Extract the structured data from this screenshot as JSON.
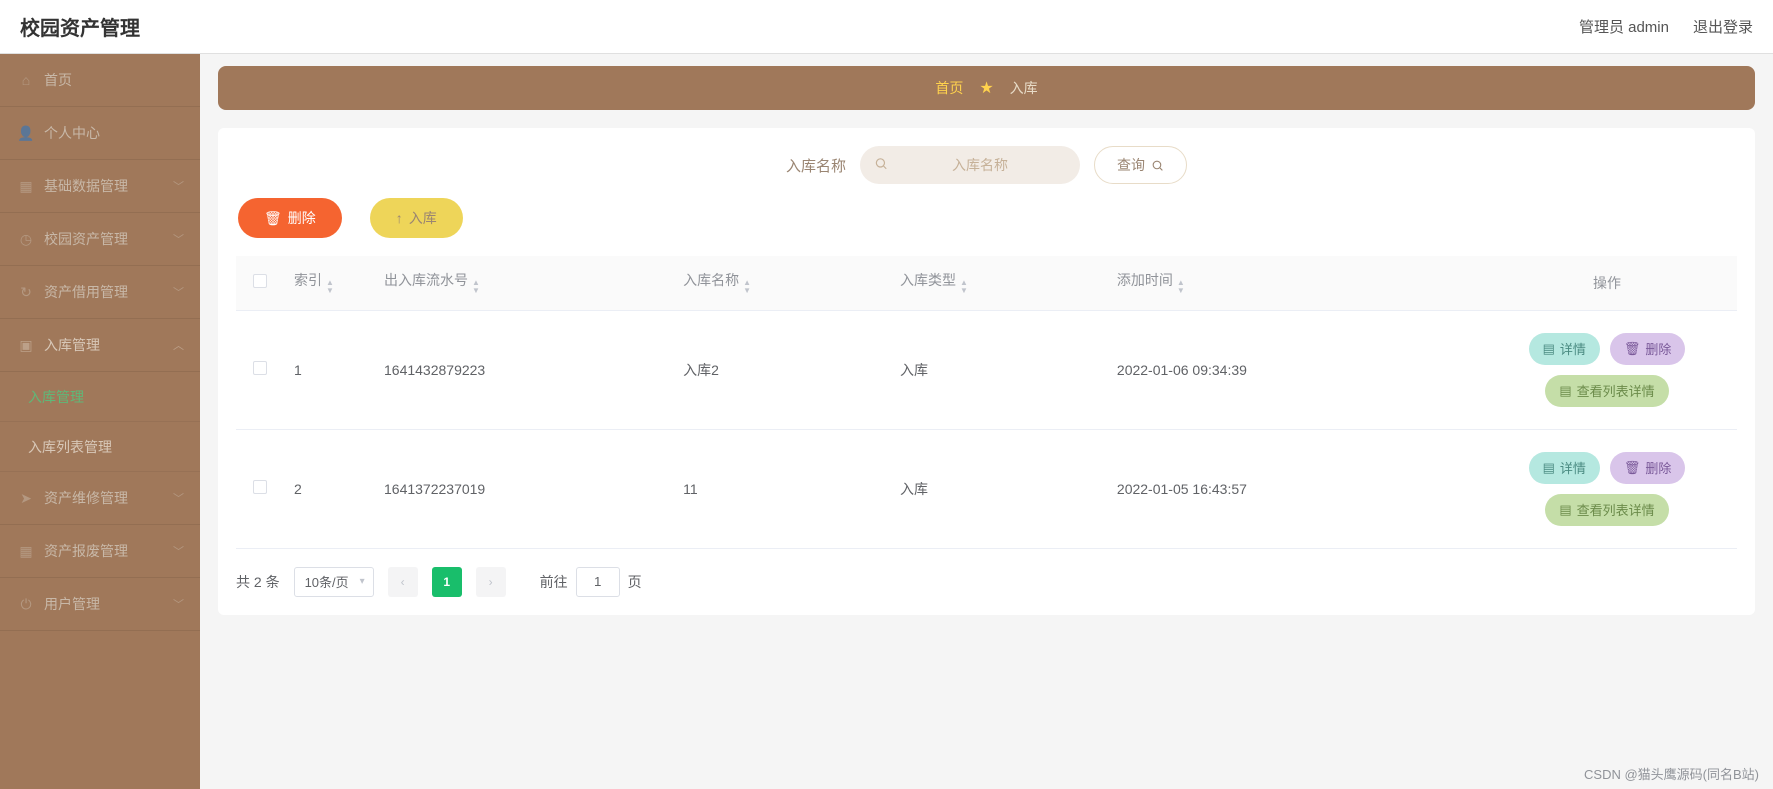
{
  "header": {
    "title": "校园资产管理",
    "user_label": "管理员 admin",
    "logout": "退出登录"
  },
  "sidebar": {
    "items": [
      {
        "label": "首页",
        "icon": "home",
        "expandable": false
      },
      {
        "label": "个人中心",
        "icon": "user",
        "expandable": false
      },
      {
        "label": "基础数据管理",
        "icon": "grid",
        "expandable": true
      },
      {
        "label": "校园资产管理",
        "icon": "clock",
        "expandable": true
      },
      {
        "label": "资产借用管理",
        "icon": "loop",
        "expandable": true
      },
      {
        "label": "入库管理",
        "icon": "folder",
        "expandable": true,
        "open": true,
        "children": [
          {
            "label": "入库管理",
            "active": true
          },
          {
            "label": "入库列表管理",
            "active": false
          }
        ]
      },
      {
        "label": "资产维修管理",
        "icon": "send",
        "expandable": true
      },
      {
        "label": "资产报废管理",
        "icon": "apps",
        "expandable": true
      },
      {
        "label": "用户管理",
        "icon": "power",
        "expandable": true
      }
    ]
  },
  "breadcrumb": {
    "home": "首页",
    "current": "入库"
  },
  "search": {
    "label": "入库名称",
    "placeholder": "入库名称",
    "query_btn": "查询"
  },
  "actions": {
    "delete": "删除",
    "add": "入库"
  },
  "table": {
    "columns": [
      "索引",
      "出入库流水号",
      "入库名称",
      "入库类型",
      "添加时间",
      "操作"
    ],
    "rows": [
      {
        "index": "1",
        "serial": "1641432879223",
        "name": "入库2",
        "type": "入库",
        "time": "2022-01-06 09:34:39"
      },
      {
        "index": "2",
        "serial": "1641372237019",
        "name": "11",
        "type": "入库",
        "time": "2022-01-05 16:43:57"
      }
    ],
    "row_actions": {
      "detail": "详情",
      "delete": "删除",
      "list_detail": "查看列表详情"
    }
  },
  "pagination": {
    "total_text": "共 2 条",
    "per_page": "10条/页",
    "current": "1",
    "jump_prefix": "前往",
    "jump_value": "1",
    "jump_suffix": "页"
  },
  "footer": "CSDN @猫头鹰源码(同名B站)"
}
